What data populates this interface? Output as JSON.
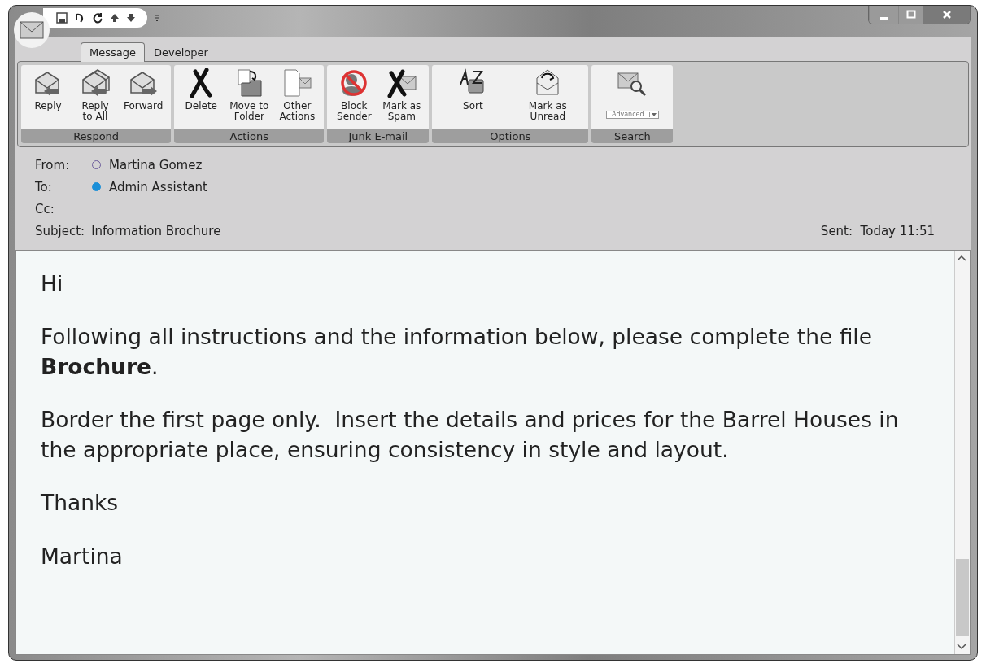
{
  "tabs": [
    {
      "label": "Message",
      "selected": true
    },
    {
      "label": "Developer",
      "selected": false
    }
  ],
  "ribbon": [
    {
      "label": "Respond",
      "buttons": [
        {
          "label": "Reply"
        },
        {
          "label": "Reply\nto All"
        },
        {
          "label": "Forward"
        }
      ]
    },
    {
      "label": "Actions",
      "buttons": [
        {
          "label": "Delete"
        },
        {
          "label": "Move to\nFolder"
        },
        {
          "label": "Other\nActions"
        }
      ]
    },
    {
      "label": "Junk E-mail",
      "buttons": [
        {
          "label": "Block\nSender"
        },
        {
          "label": "Mark as\nSpam"
        }
      ]
    },
    {
      "label": "Options",
      "buttons": [
        {
          "label": "Sort"
        },
        {
          "label": "Mark as\nUnread"
        }
      ]
    },
    {
      "label": "Search",
      "buttons": [
        {
          "dropdown": "Advanced"
        }
      ]
    }
  ],
  "header": [
    {
      "label": "From:",
      "value": "Martina Gomez",
      "filled": false,
      "color": "#6a5a9a"
    },
    {
      "label": "To:",
      "value": "Admin Assistant",
      "filled": true,
      "color": "#1a8fd8"
    },
    {
      "label": "Cc:"
    },
    {
      "label": "Subject:",
      "value": "Information Brochure"
    }
  ],
  "sent": {
    "label": "Sent:",
    "value": "Today 11:51"
  },
  "body": [
    "Hi",
    "Following all instructions and the information below, please complete the file **Brochure**.",
    "Border the first page only.  Insert the details and prices for the Barrel Houses in the appropriate place, ensuring consistency in style and layout.",
    "Thanks",
    "Martina"
  ]
}
